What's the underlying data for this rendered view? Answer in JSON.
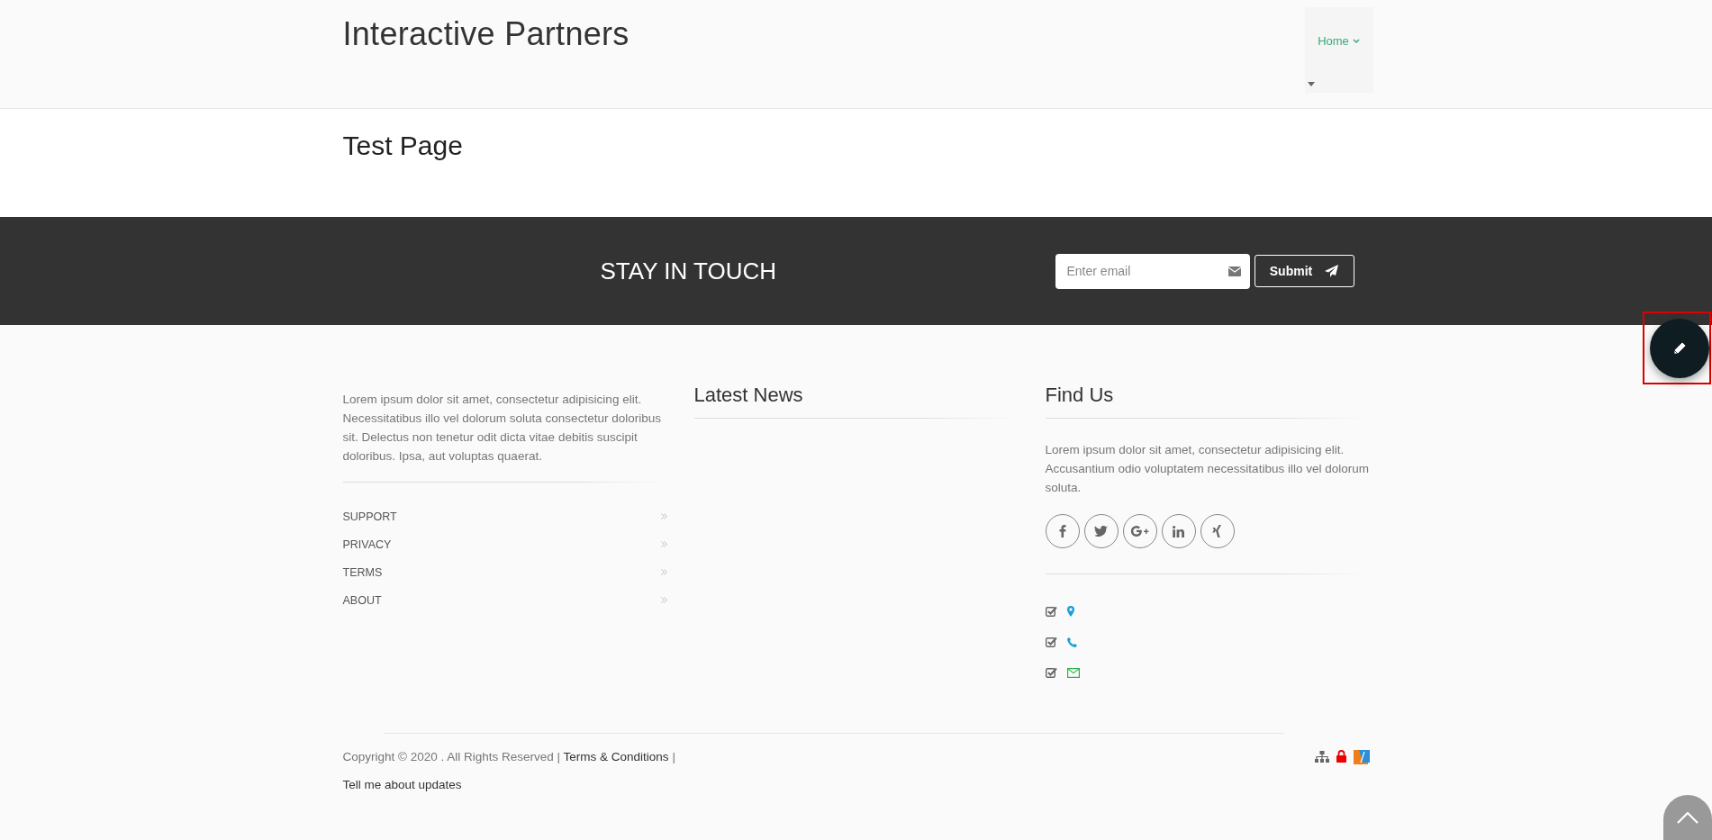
{
  "header": {
    "site_title": "Interactive Partners",
    "nav": [
      {
        "label": "Home",
        "selected": true
      }
    ]
  },
  "page": {
    "title": "Test Page"
  },
  "newsletter": {
    "heading": "STAY IN TOUCH",
    "email": {
      "placeholder": "Enter email"
    },
    "submit": "Submit"
  },
  "footer": {
    "about": {
      "text": "Lorem ipsum dolor sit amet, consectetur adipisicing elit. Necessitatibus illo vel dolorum soluta consectetur doloribus sit. Delectus non tenetur odit dicta vitae debitis suscipit doloribus. Ipsa, aut voluptas quaerat.",
      "links": [
        "SUPPORT",
        "PRIVACY",
        "TERMS",
        "ABOUT"
      ]
    },
    "news": {
      "heading": "Latest News"
    },
    "find_us": {
      "heading": "Find Us",
      "text": "Lorem ipsum dolor sit amet, consectetur adipisicing elit. Accusantium odio voluptatem necessitatibus illo vel dolorum soluta.",
      "socials": [
        {
          "kind": "facebook"
        },
        {
          "kind": "twitter"
        },
        {
          "kind": "googleplus"
        },
        {
          "kind": "linkedin"
        },
        {
          "kind": "xing"
        }
      ],
      "contacts": [
        {
          "kind": "location",
          "checked": true,
          "color": "#1a9fd9"
        },
        {
          "kind": "phone",
          "checked": true,
          "color": "#1a9fd9"
        },
        {
          "kind": "mail",
          "checked": true,
          "color": "#2ab34a"
        }
      ]
    }
  },
  "bottom": {
    "copyright": "Copyright © 2020 . All Rights Reserved |",
    "terms_link": "Terms & Conditions",
    "separator": "|",
    "updates_link": "Tell me about updates",
    "badges": [
      {
        "kind": "sitemap"
      },
      {
        "kind": "lock"
      },
      {
        "kind": "logo"
      }
    ]
  },
  "edit_button": {
    "highlighted": true
  }
}
